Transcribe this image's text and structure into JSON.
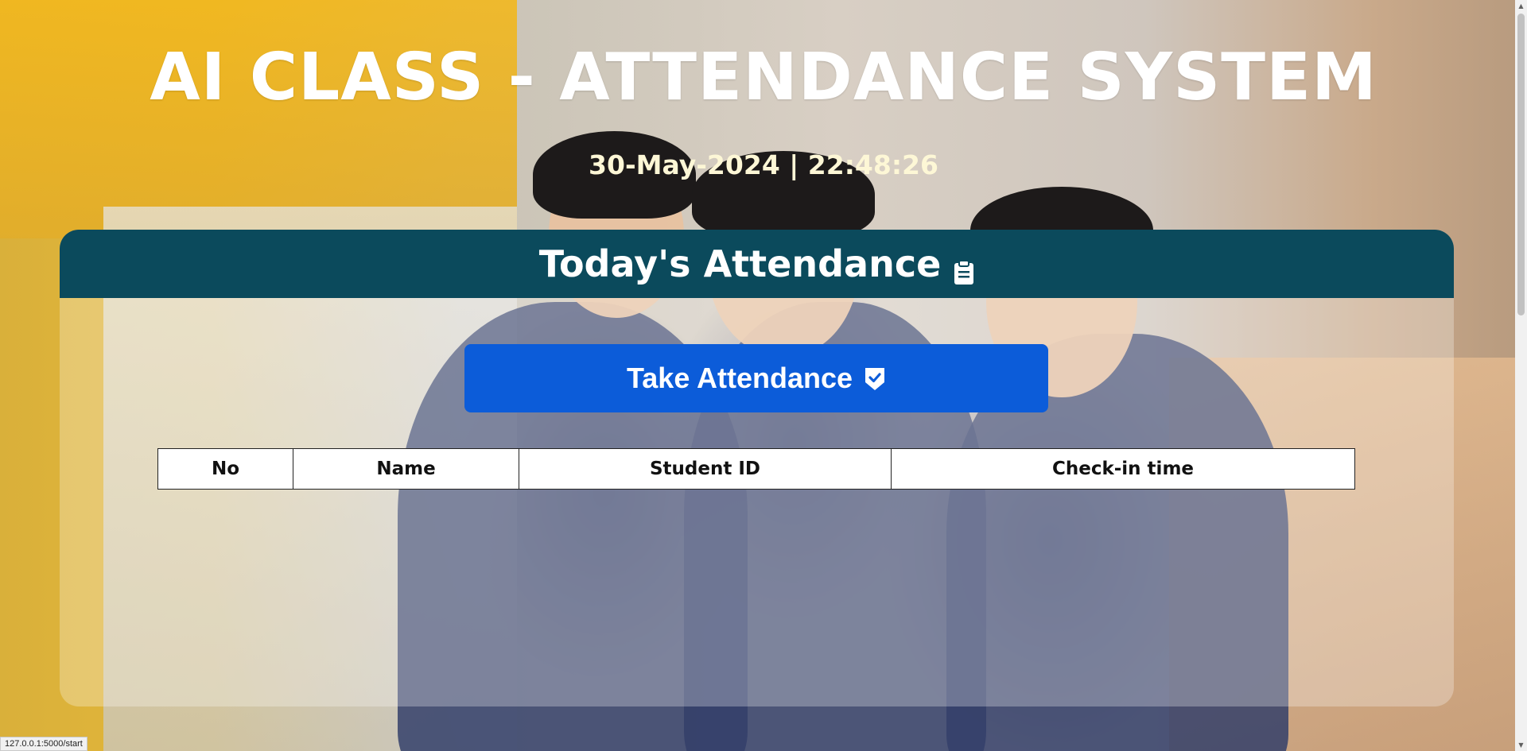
{
  "header": {
    "title": "AI CLASS - ATTENDANCE SYSTEM",
    "datetime": "30-May-2024 | 22:48:26"
  },
  "attendance_card": {
    "title": "Today's Attendance",
    "title_icon": "clipboard-icon",
    "take_attendance_label": "Take Attendance",
    "take_attendance_icon": "check-shield-icon",
    "table": {
      "columns": [
        "No",
        "Name",
        "Student ID",
        "Check-in time"
      ],
      "rows": []
    }
  },
  "status_bar": {
    "url": "127.0.0.1:5000/start"
  },
  "colors": {
    "header_bg": "#0b4a5c",
    "button_bg": "#0c5cd9",
    "title_text": "#ffffff",
    "datetime_text": "#fdf7d6"
  }
}
